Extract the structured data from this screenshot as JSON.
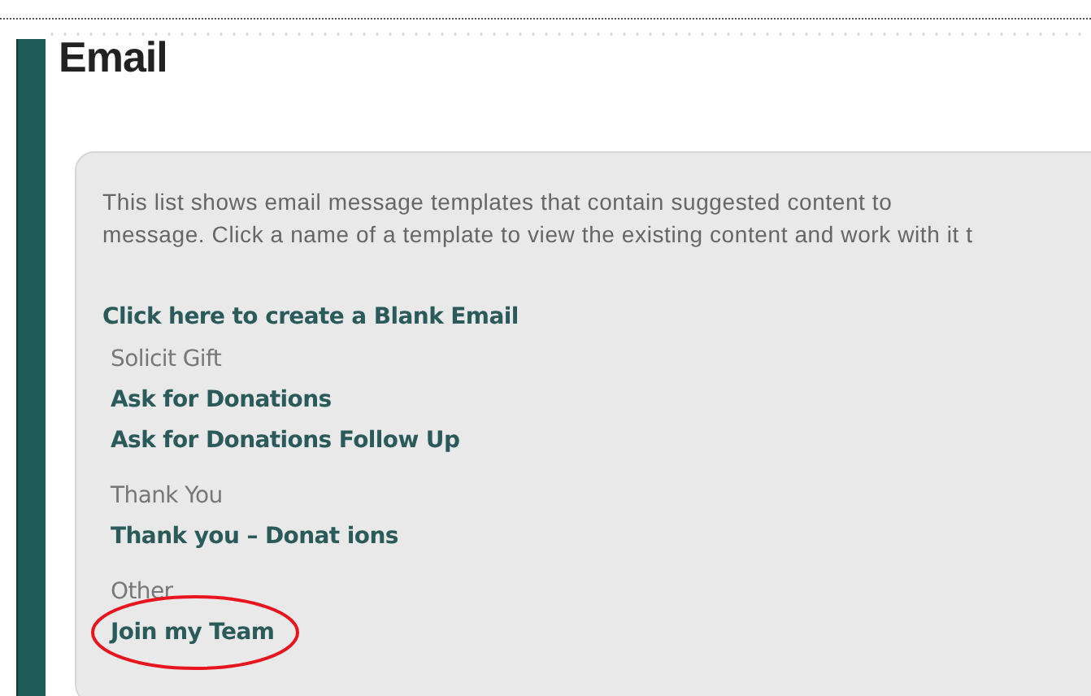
{
  "page": {
    "title": "Email"
  },
  "intro_lines": [
    "This list shows email message templates that contain suggested content to",
    "message. Click a name of a template to view the existing content and work with it t"
  ],
  "blank_link": "Click here to create a Blank Email",
  "groups": [
    {
      "name": "Solicit Gift",
      "templates": [
        {
          "label": "Ask for Donations",
          "highlighted": false
        },
        {
          "label": "Ask for Donations Follow Up",
          "highlighted": false
        }
      ]
    },
    {
      "name": "Thank You",
      "templates": [
        {
          "label": "Thank you – Donat ions",
          "highlighted": false
        }
      ]
    },
    {
      "name": "Other",
      "templates": [
        {
          "label": "Join my Team",
          "highlighted": true
        }
      ]
    }
  ]
}
